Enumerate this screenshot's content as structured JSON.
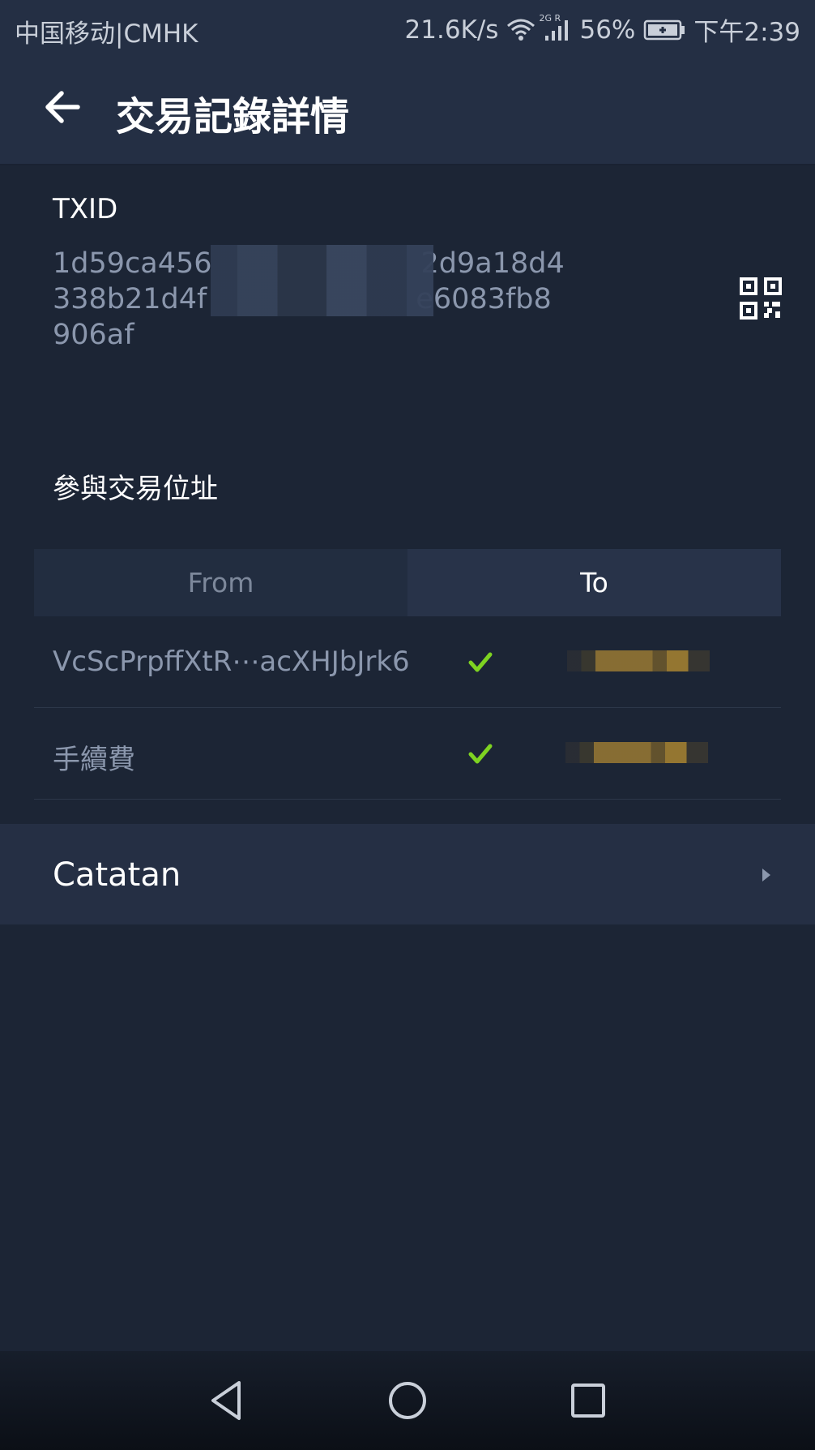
{
  "status_bar": {
    "carrier": "中国移动|CMHK",
    "speed": "21.6K/s",
    "network": "2G R",
    "battery": "56%",
    "time": "下午2:39"
  },
  "app_bar": {
    "title": "交易記錄詳情",
    "back_icon": "arrow-left-icon"
  },
  "txid": {
    "label": "TXID",
    "lines": [
      "1d59ca456",
      "338b21d4f",
      "906af"
    ],
    "line_endings": [
      "2d9a18d4",
      "e6083fb8"
    ],
    "qr_icon": "qr-code-icon"
  },
  "addresses": {
    "label": "參與交易位址",
    "tabs": [
      {
        "label": "From",
        "selected": false
      },
      {
        "label": "To",
        "selected": true
      }
    ],
    "rows": [
      {
        "address": "VcScPrpffXtR⋯acXHJbJrk6",
        "verified": true
      },
      {
        "address": "手續費",
        "verified": true
      }
    ]
  },
  "catatan": {
    "label": "Catatan",
    "icon": "chevron-right-icon"
  },
  "nav": {
    "back": "triangle-back-icon",
    "home": "circle-home-icon",
    "recents": "square-recents-icon"
  },
  "colors": {
    "background": "#1c2535",
    "header": "#242f44",
    "check": "#7ed321",
    "muted_text": "#8b97ad"
  }
}
